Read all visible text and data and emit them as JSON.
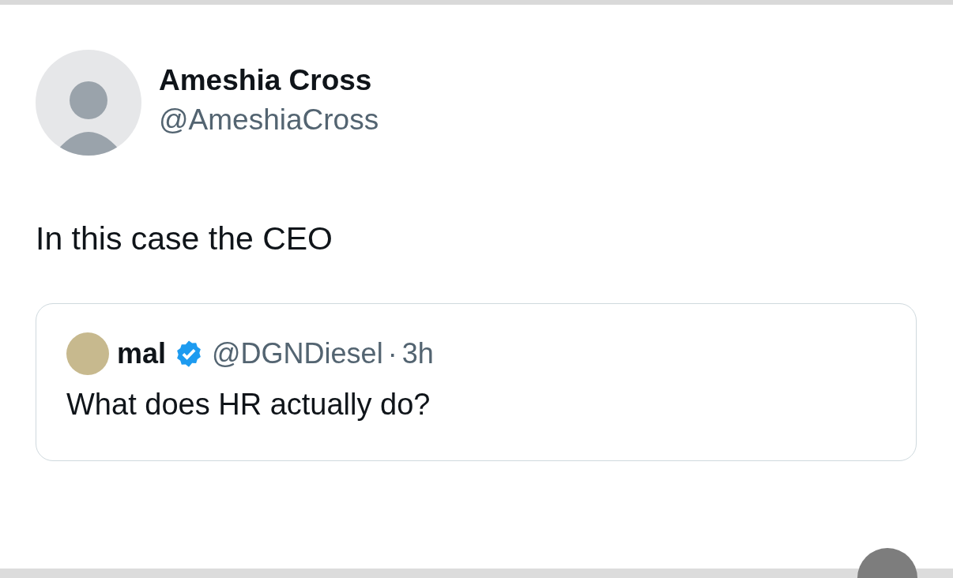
{
  "author": {
    "name": "Ameshia Cross",
    "handle": "@AmeshiaCross"
  },
  "text": "In this case the CEO",
  "quoted": {
    "name": "mal",
    "verified": true,
    "handle": "@DGNDiesel",
    "separator": "·",
    "time": "3h",
    "text": "What does HR actually do?"
  }
}
